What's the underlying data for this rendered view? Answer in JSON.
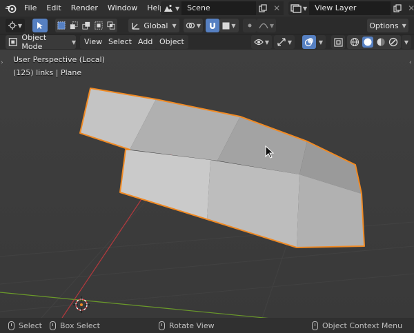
{
  "topbar": {
    "menu": [
      "File",
      "Edit",
      "Render",
      "Window",
      "Help"
    ],
    "scene_name": "Scene",
    "view_layer_name": "View Layer"
  },
  "header": {
    "orientation_label": "Global",
    "options_label": "Options"
  },
  "viewport_menu": {
    "mode_label": "Object Mode",
    "items": [
      "View",
      "Select",
      "Add",
      "Object"
    ]
  },
  "viewport": {
    "perspective_label": "User Perspective (Local)",
    "object_info": "(125) links | Plane"
  },
  "statusbar": {
    "select": "Select",
    "box_select": "Box Select",
    "rotate_view": "Rotate View",
    "context_menu": "Object Context Menu"
  },
  "colors": {
    "accent": "#5680c2",
    "selection_outline": "#f08a24",
    "grid_x_axis": "#b5393d",
    "grid_y_axis": "#6b9a2a"
  }
}
